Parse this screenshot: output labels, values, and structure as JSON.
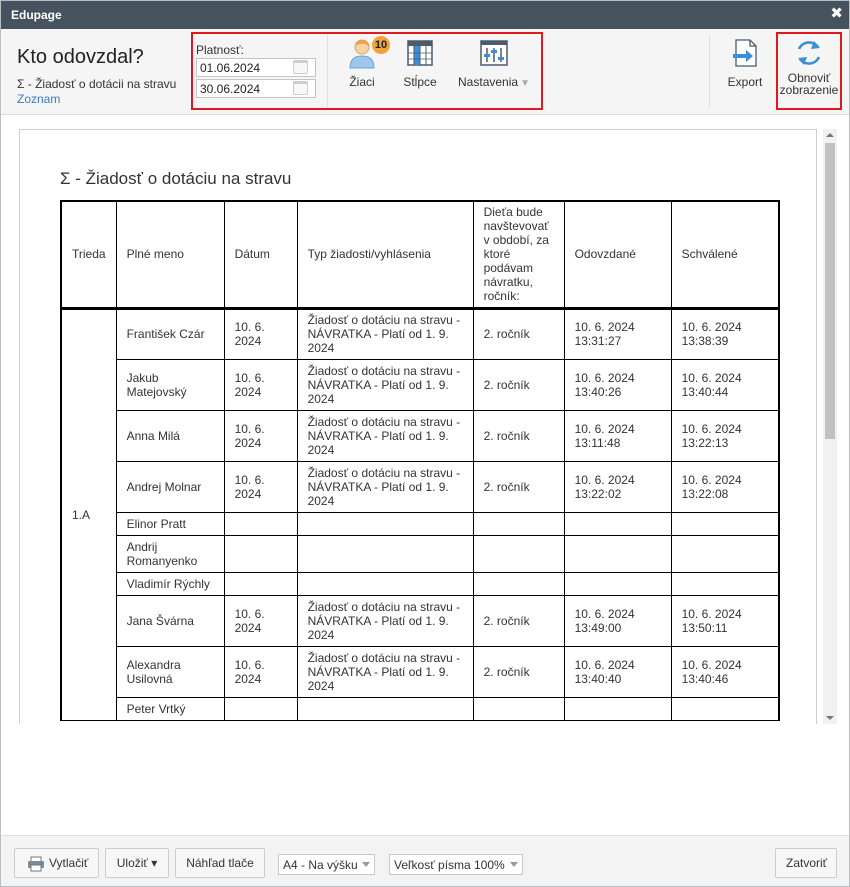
{
  "window": {
    "title": "Edupage",
    "close_glyph": "✖"
  },
  "toolbar": {
    "heading": "Kto odovzdal?",
    "subtitle": "Σ - Žiadosť o dotácii na stravu",
    "link": "Zoznam",
    "validity_label": "Platnosť:",
    "date_from": "01.06.2024",
    "date_to": "30.06.2024",
    "students_label": "Žiaci",
    "students_badge": "10",
    "columns_label": "Stĺpce",
    "settings_label": "Nastavenia",
    "export_label": "Export",
    "refresh_label_1": "Obnoviť",
    "refresh_label_2": "zobrazenie"
  },
  "report": {
    "title": "Σ - Žiadosť o dotáciu na stravu",
    "class_name": "1.A",
    "columns": [
      "Trieda",
      "Plné meno",
      "Dátum",
      "Typ žiadosti/vyhlásenia",
      "Dieťa bude navštevovať v období, za ktoré podávam návratku, ročník:",
      "Odovzdané",
      "Schválené"
    ],
    "rows": [
      {
        "name": "František Czár",
        "date": "10. 6. 2024",
        "type": "Žiadosť o dotáciu na stravu - NÁVRATKA - Platí od 1. 9. 2024",
        "grade": "2. ročník",
        "submitted": "10. 6. 2024 13:31:27",
        "approved": "10. 6. 2024 13:38:39"
      },
      {
        "name": "Jakub Matejovský",
        "date": "10. 6. 2024",
        "type": "Žiadosť o dotáciu na stravu - NÁVRATKA - Platí od 1. 9. 2024",
        "grade": "2. ročník",
        "submitted": "10. 6. 2024 13:40:26",
        "approved": "10. 6. 2024 13:40:44"
      },
      {
        "name": "Anna Milá",
        "date": "10. 6. 2024",
        "type": "Žiadosť o dotáciu na stravu - NÁVRATKA - Platí od 1. 9. 2024",
        "grade": "2. ročník",
        "submitted": "10. 6. 2024 13:11:48",
        "approved": "10. 6. 2024 13:22:13"
      },
      {
        "name": "Andrej Molnar",
        "date": "10. 6. 2024",
        "type": "Žiadosť o dotáciu na stravu - NÁVRATKA - Platí od 1. 9. 2024",
        "grade": "2. ročník",
        "submitted": "10. 6. 2024 13:22:02",
        "approved": "10. 6. 2024 13:22:08"
      },
      {
        "name": "Elinor Pratt",
        "date": "",
        "type": "",
        "grade": "",
        "submitted": "",
        "approved": ""
      },
      {
        "name": "Andrij Romanyenko",
        "date": "",
        "type": "",
        "grade": "",
        "submitted": "",
        "approved": ""
      },
      {
        "name": "Vladimír Rýchly",
        "date": "",
        "type": "",
        "grade": "",
        "submitted": "",
        "approved": ""
      },
      {
        "name": "Jana Švárna",
        "date": "10. 6. 2024",
        "type": "Žiadosť o dotáciu na stravu - NÁVRATKA - Platí od 1. 9. 2024",
        "grade": "2. ročník",
        "submitted": "10. 6. 2024 13:49:00",
        "approved": "10. 6. 2024 13:50:11"
      },
      {
        "name": "Alexandra Usilovná",
        "date": "10. 6. 2024",
        "type": "Žiadosť o dotáciu na stravu - NÁVRATKA - Platí od 1. 9. 2024",
        "grade": "2. ročník",
        "submitted": "10. 6. 2024 13:40:40",
        "approved": "10. 6. 2024 13:40:46"
      },
      {
        "name": "Peter Vrtký",
        "date": "",
        "type": "",
        "grade": "",
        "submitted": "",
        "approved": ""
      }
    ]
  },
  "footer": {
    "print_label": "Vytlačiť",
    "save_label": "Uložiť ▾",
    "preview_label": "Náhľad tlače",
    "page_format": "A4 - Na výšku",
    "font_size": "Veľkosť písma 100%",
    "close_label": "Zatvoriť"
  },
  "colors": {
    "titlebar": "#46525e",
    "highlight_border": "#e0191e",
    "badge": "#f2a23a",
    "link": "#3a7abf",
    "icon_blue": "#3b8fd9"
  }
}
